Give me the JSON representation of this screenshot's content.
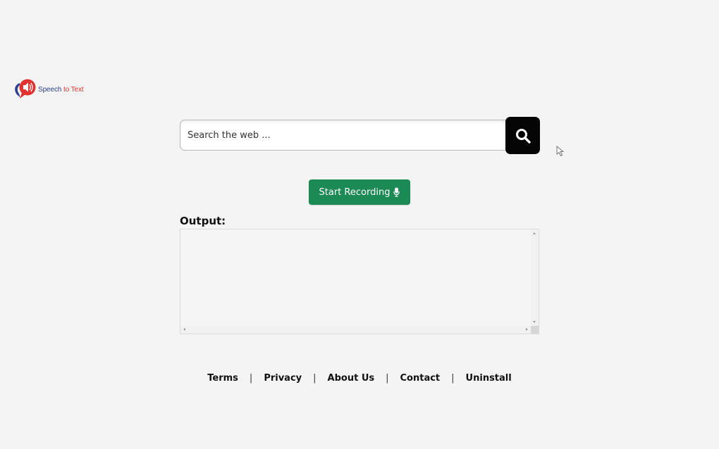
{
  "logo": {
    "word1": "Speech",
    "word2": "to Text",
    "colors": {
      "blue": "#2f3f8f",
      "red": "#e0332f"
    }
  },
  "search": {
    "placeholder": "Search the web ...",
    "value": "",
    "button_icon": "search-icon"
  },
  "record": {
    "label": "Start Recording",
    "icon": "microphone-icon",
    "color": "#1c8a55"
  },
  "output": {
    "label": "Output:",
    "value": ""
  },
  "footer": {
    "links": [
      {
        "label": "Terms"
      },
      {
        "label": "Privacy"
      },
      {
        "label": "About Us"
      },
      {
        "label": "Contact"
      },
      {
        "label": "Uninstall"
      }
    ],
    "separator": "|"
  }
}
